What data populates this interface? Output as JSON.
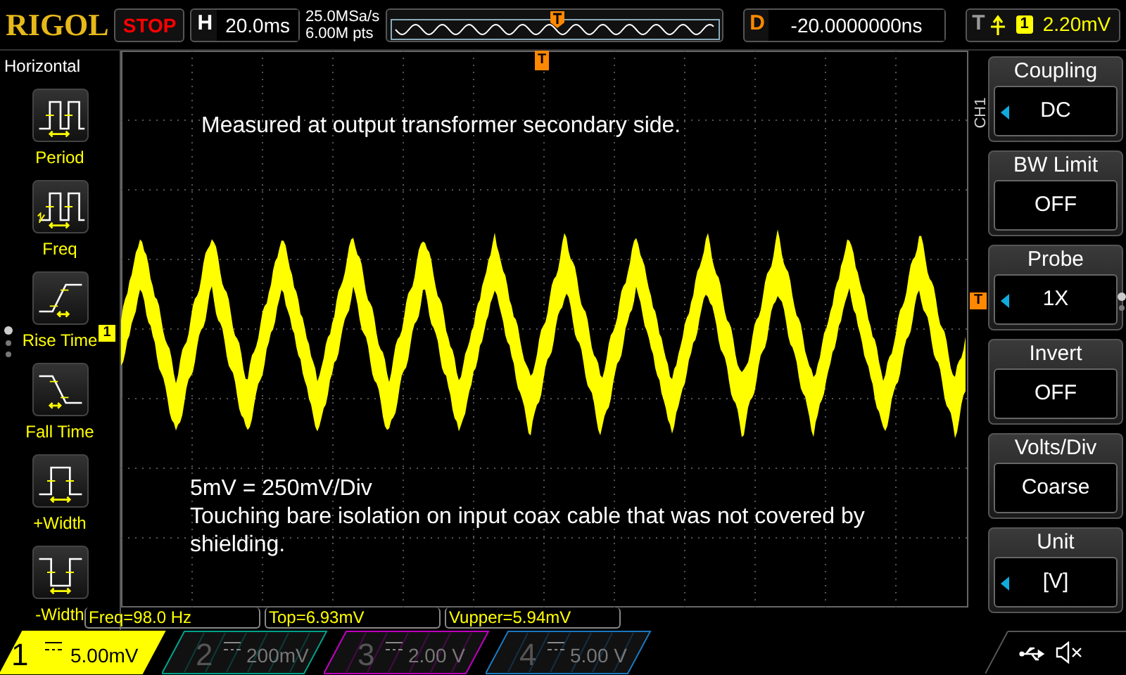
{
  "header": {
    "logo": "RIGOL",
    "run_state": "STOP",
    "timebase": {
      "label": "H",
      "value": "20.0ms"
    },
    "sample_rate": "25.0MSa/s",
    "memory_depth": "6.00M pts",
    "delay": {
      "label": "D",
      "value": "-20.0000000ns"
    },
    "trigger": {
      "label": "T",
      "source": "1",
      "level": "2.20mV"
    }
  },
  "left_menu": {
    "title": "Horizontal",
    "page_dots": [
      {
        "selected": true
      },
      {
        "selected": false
      },
      {
        "selected": false
      }
    ],
    "items": [
      {
        "kind": "period",
        "label": "Period"
      },
      {
        "kind": "freq",
        "label": "Freq"
      },
      {
        "kind": "rise",
        "label": "Rise Time"
      },
      {
        "kind": "fall",
        "label": "Fall Time"
      },
      {
        "kind": "pwidth",
        "label": "+Width"
      },
      {
        "kind": "nwidth",
        "label": "-Width"
      }
    ]
  },
  "screen": {
    "trigger_position_marker": "T",
    "channel_marker": "1",
    "trigger_level_marker": "T",
    "annotations": [
      "Measured at output transformer secondary side.",
      "5mV = 250mV/Div",
      "Touching bare isolation on input coax cable that was not covered by shielding."
    ]
  },
  "right_menu": {
    "channel": "CH1",
    "page_dots": [
      {
        "selected": true
      },
      {
        "selected": false
      }
    ],
    "items": [
      {
        "title": "Coupling",
        "value": "DC",
        "adjustable": true
      },
      {
        "title": "BW Limit",
        "value": "OFF",
        "adjustable": false
      },
      {
        "title": "Probe",
        "value": "1X",
        "adjustable": true
      },
      {
        "title": "Invert",
        "value": "OFF",
        "adjustable": false
      },
      {
        "title": "Volts/Div",
        "value": "Coarse",
        "adjustable": false
      },
      {
        "title": "Unit",
        "value": "[V]",
        "adjustable": true
      }
    ]
  },
  "measurements": [
    "Freq=98.0 Hz",
    "Top=6.93mV",
    "Vupper=5.94mV"
  ],
  "channels": [
    {
      "number": "1",
      "scale": "5.00mV",
      "selected": true,
      "color": "#ffff00"
    },
    {
      "number": "2",
      "scale": "200mV",
      "selected": false,
      "color": "#00a08a"
    },
    {
      "number": "3",
      "scale": "2.00 V",
      "selected": false,
      "color": "#c000c0"
    },
    {
      "number": "4",
      "scale": "5.00 V",
      "selected": false,
      "color": "#1a78c0"
    }
  ]
}
